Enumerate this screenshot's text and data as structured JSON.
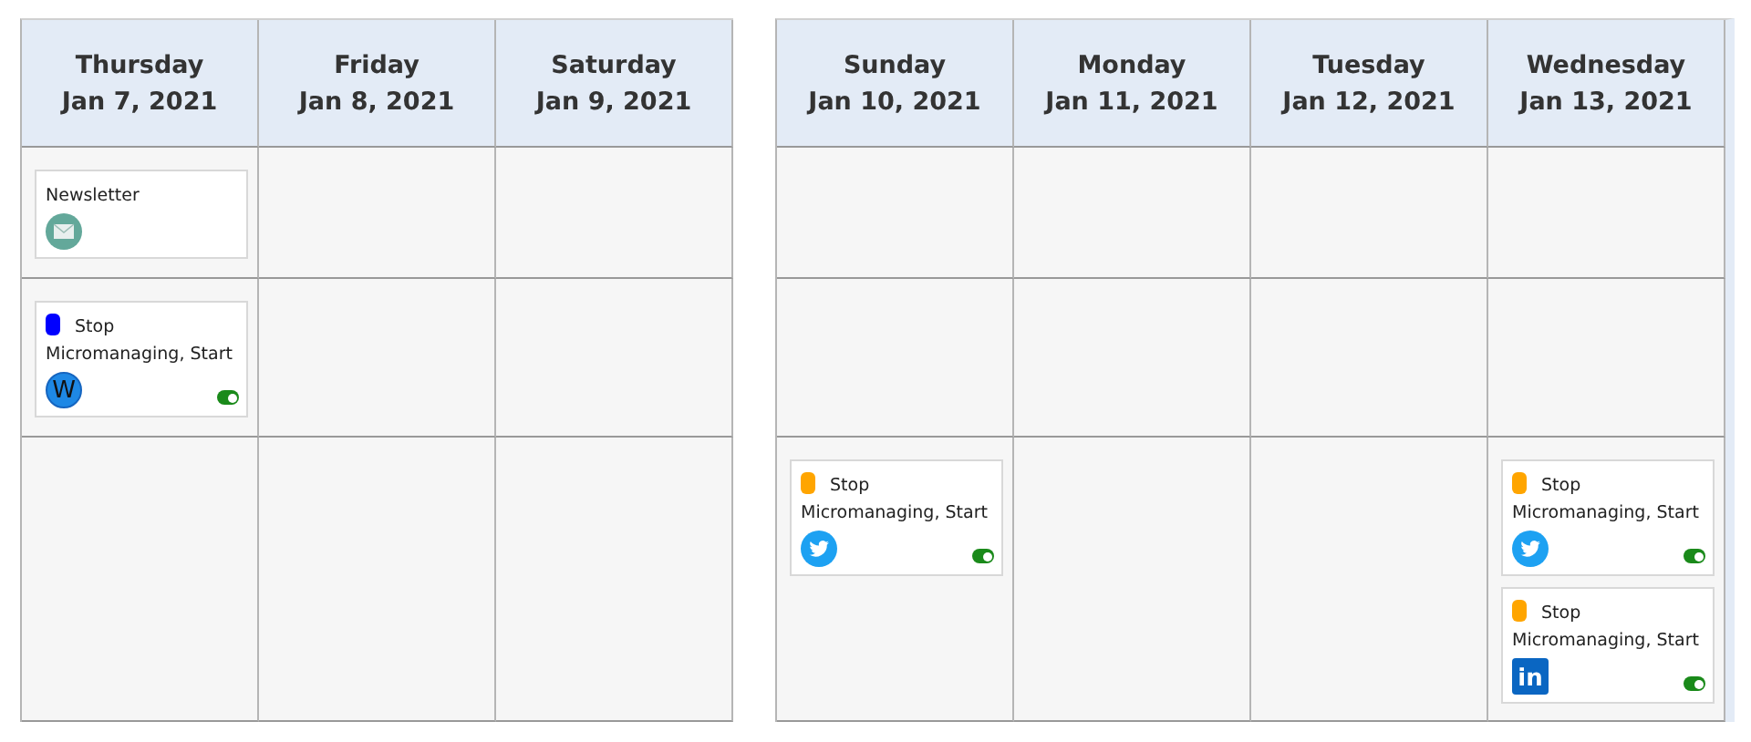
{
  "panels": [
    {
      "days": [
        {
          "weekday": "Thursday",
          "date": "Jan 7, 2021"
        },
        {
          "weekday": "Friday",
          "date": "Jan 8, 2021"
        },
        {
          "weekday": "Saturday",
          "date": "Jan 9, 2021"
        }
      ],
      "rows": [
        {
          "cells": [
            {
              "posts": [
                {
                  "kind": "newsletter",
                  "title": "Newsletter"
                }
              ]
            },
            {},
            {}
          ]
        },
        {
          "cells": [
            {
              "posts": [
                {
                  "kind": "letter",
                  "title": "Stop Micromanaging, Start",
                  "color": "#0000ff",
                  "logo_text": "W",
                  "on": true
                }
              ]
            },
            {},
            {}
          ]
        },
        {
          "cells": [
            {},
            {},
            {}
          ]
        }
      ]
    },
    {
      "days": [
        {
          "weekday": "Sunday",
          "date": "Jan 10, 2021"
        },
        {
          "weekday": "Monday",
          "date": "Jan 11, 2021"
        },
        {
          "weekday": "Tuesday",
          "date": "Jan 12, 2021"
        },
        {
          "weekday": "Wednesday",
          "date": "Jan 13, 2021"
        }
      ],
      "rows": [
        {
          "cells": [
            {},
            {},
            {},
            {}
          ]
        },
        {
          "cells": [
            {},
            {},
            {},
            {}
          ]
        },
        {
          "cells": [
            {
              "posts": [
                {
                  "kind": "bird",
                  "title": "Stop Micromanaging, Start",
                  "color": "#ffa500",
                  "on": true
                }
              ]
            },
            {},
            {},
            {
              "posts": [
                {
                  "kind": "bird",
                  "title": "Stop Micromanaging, Start",
                  "color": "#ffa500",
                  "on": true
                },
                {
                  "kind": "square",
                  "title": "Stop Micromanaging, Start",
                  "color": "#ffa500",
                  "logo_text": "in",
                  "on": true
                }
              ]
            }
          ]
        }
      ]
    }
  ]
}
